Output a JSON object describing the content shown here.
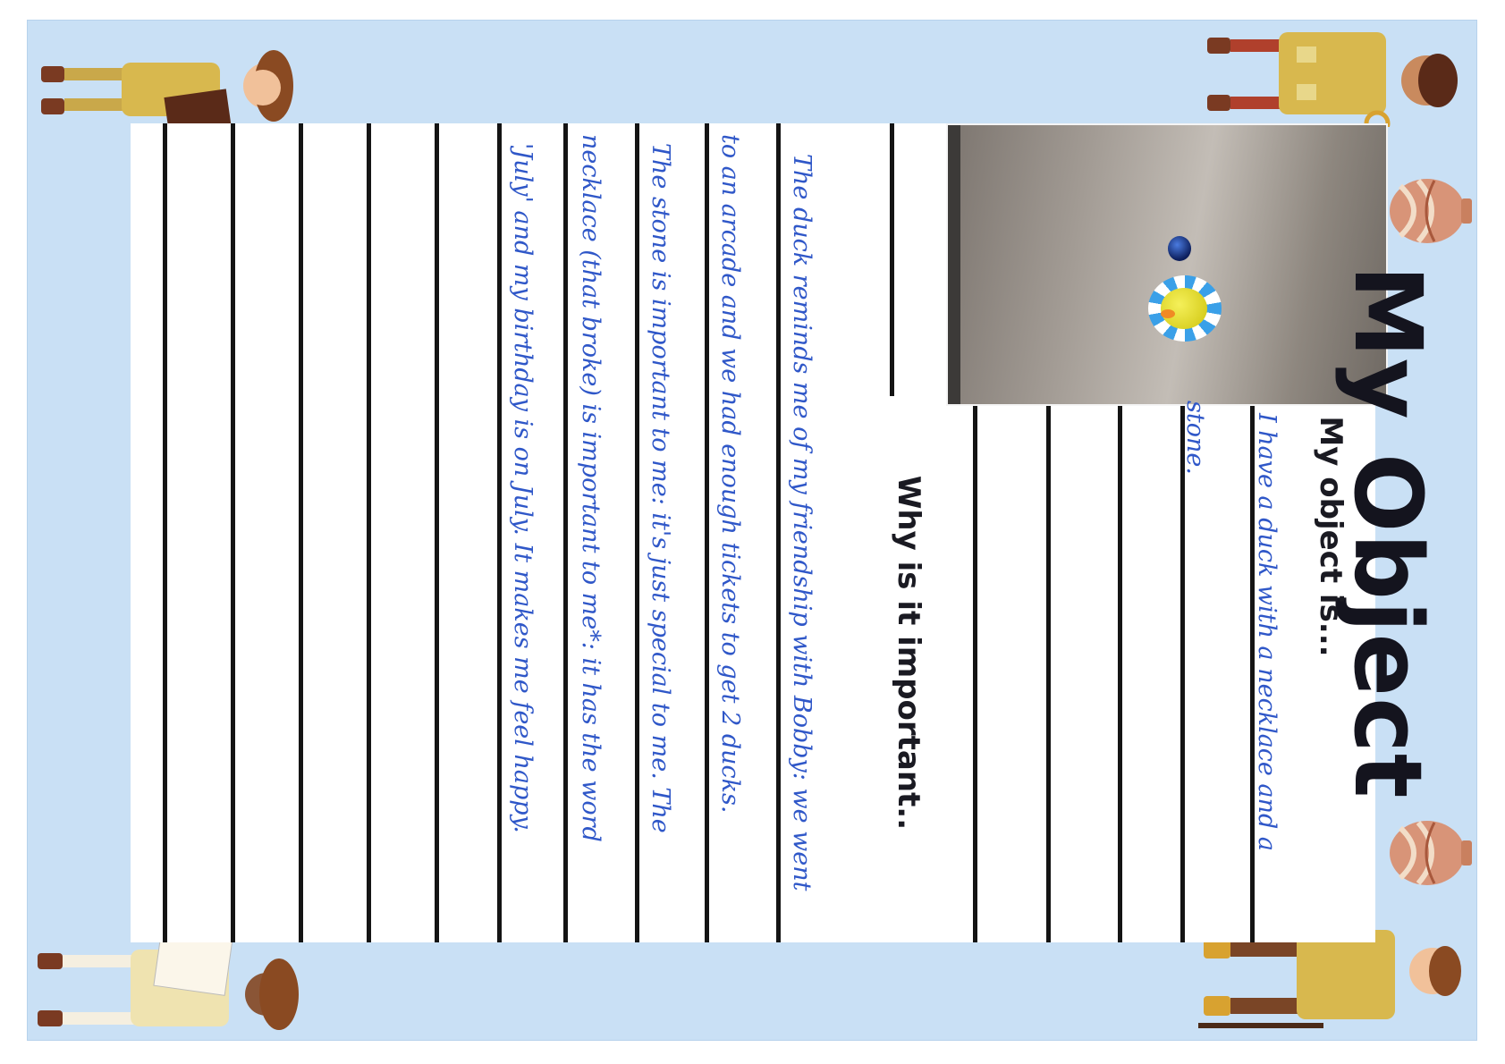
{
  "worksheet": {
    "title": "My Object",
    "object_heading": "My object is...",
    "importance_heading": "Why is it important..",
    "colors": {
      "background": "#c9e0f5",
      "panel": "#ffffff",
      "rule_lines": "#141414",
      "handwriting": "#2f57c8"
    }
  },
  "answers": {
    "object_lines": [
      "I have a duck with a necklace and a",
      "stone."
    ],
    "importance_lines": [
      "The duck reminds me of my friendship with Bobby: we went",
      "to an arcade and we had enough tickets to get 2 ducks.",
      "The stone is important to me: it's just special to me. The",
      "necklace (that broke) is important to me*: it has the word",
      "'July' and my birthday is on July. It makes me feel happy."
    ]
  },
  "illustrations": {
    "explorer_icon": "explorer-figure-icon",
    "pot_icon": "clay-pot-icon",
    "photo_subject": "toy-duck-photo"
  }
}
